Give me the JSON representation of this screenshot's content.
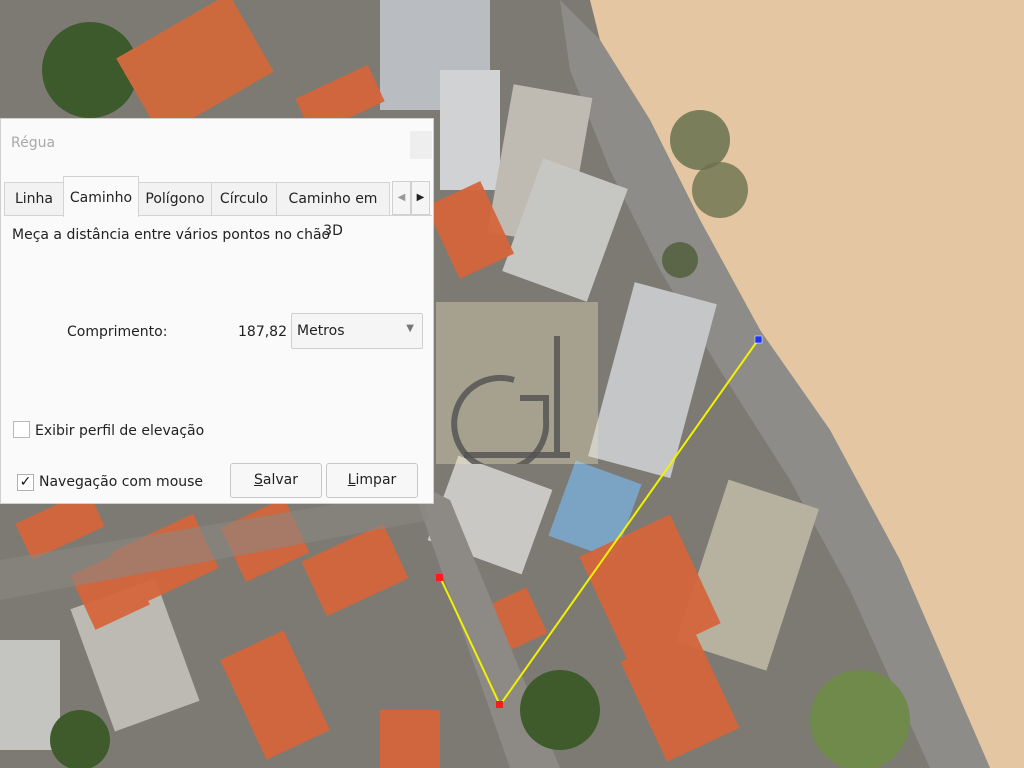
{
  "dialog": {
    "title": "Régua",
    "tabs": [
      {
        "label": "Linha"
      },
      {
        "label": "Caminho"
      },
      {
        "label": "Polígono"
      },
      {
        "label": "Círculo"
      },
      {
        "label": "Caminho em 3D"
      }
    ],
    "active_tab": "Caminho",
    "description": "Meça a distância entre vários pontos no chão",
    "length_label": "Comprimento:",
    "length_value": "187,82",
    "unit_selected": "Metros",
    "elevation_profile_label": "Exibir perfil de elevação",
    "elevation_profile_checked": false,
    "mouse_navigation_label": "Navegação com mouse",
    "mouse_navigation_checked": true,
    "save_button": {
      "mnemonic": "S",
      "rest": "alvar"
    },
    "clear_button": {
      "mnemonic": "L",
      "rest": "impar"
    }
  },
  "colors": {
    "path_line": "#f2f200",
    "start_marker": "#1a33ff",
    "vertex_marker": "#ff1a1a",
    "beach_sand": "#e6c9a4",
    "roof_tiles": "#d5663b"
  }
}
